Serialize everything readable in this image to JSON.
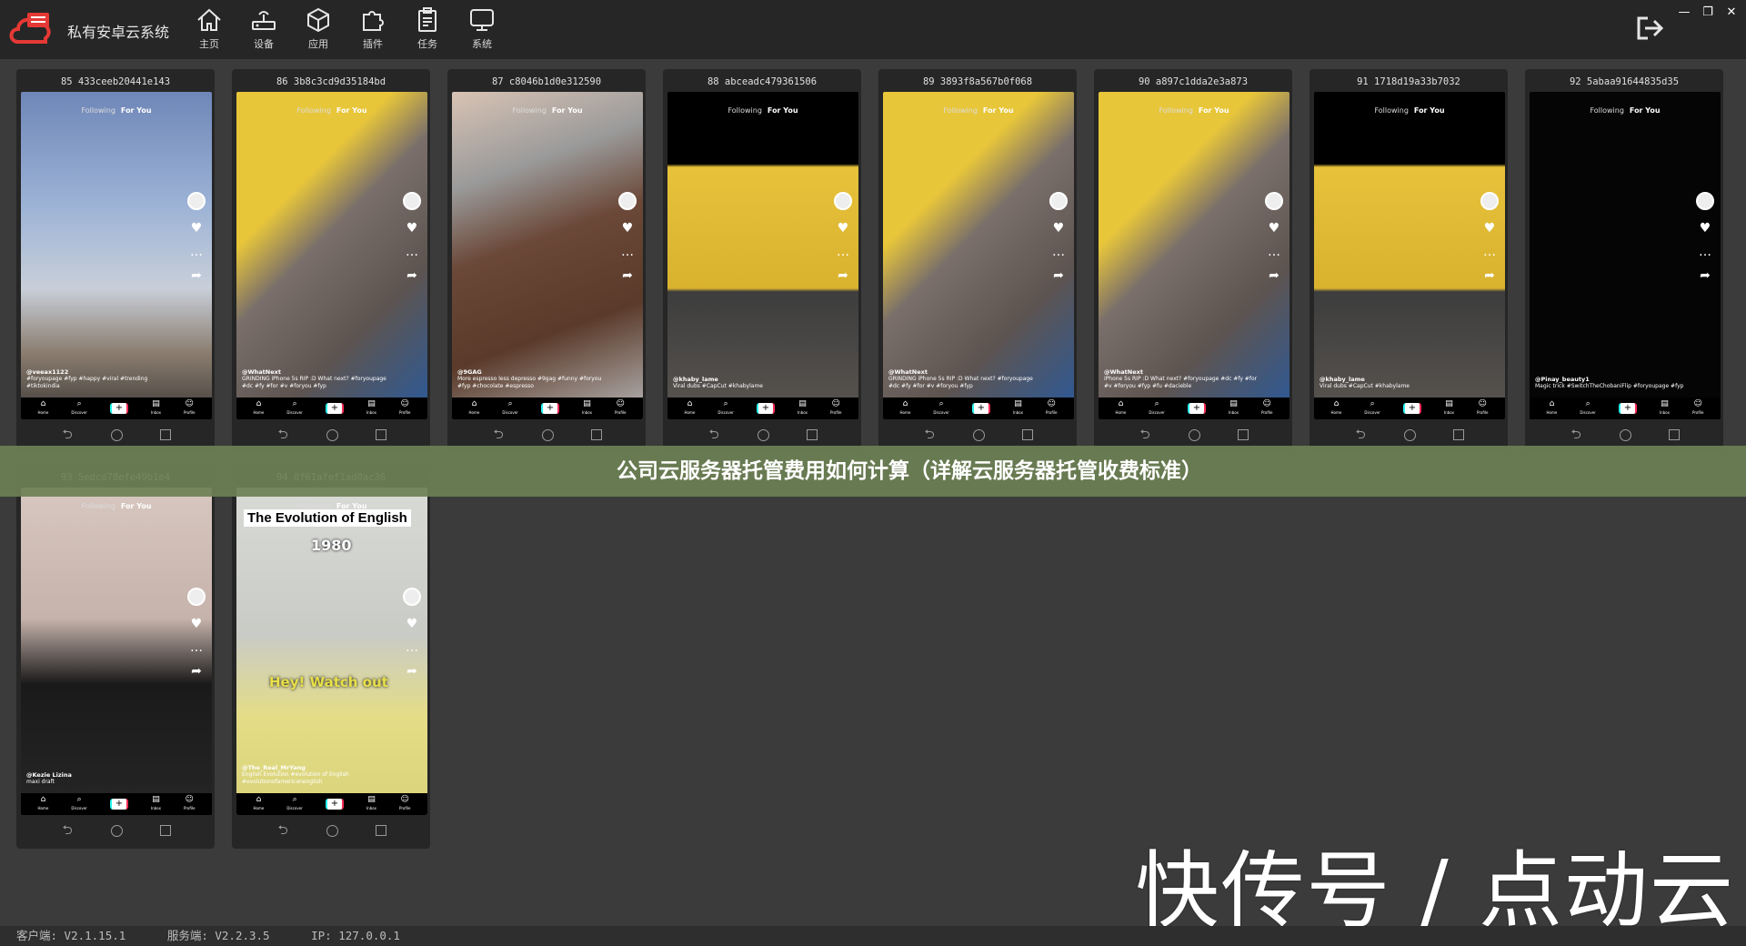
{
  "app": {
    "title": "私有安卓云系统",
    "nav": [
      {
        "label": "主页",
        "icon": "home-icon"
      },
      {
        "label": "设备",
        "icon": "device-icon"
      },
      {
        "label": "应用",
        "icon": "app-cube-icon"
      },
      {
        "label": "插件",
        "icon": "plugin-puzzle-icon"
      },
      {
        "label": "任务",
        "icon": "task-clipboard-icon"
      },
      {
        "label": "系统",
        "icon": "system-monitor-icon"
      }
    ]
  },
  "devices": [
    {
      "title": "85 433ceeb20441e143",
      "scene": "sky",
      "user": "@veeax1122",
      "caption": "#foryoupage #fyp #happy #viral #trending #tiktokindia",
      "tabs": [
        "Following",
        "For You"
      ]
    },
    {
      "title": "86 3b8c3cd9d35184bd",
      "scene": "grinder",
      "user": "@WhatNext",
      "caption": "GRINDING iPhone 5s RIP :D What next? #foryoupage #dc #fy #for #v #foryou #fyp",
      "tabs": [
        "Following",
        "For You"
      ]
    },
    {
      "title": "87 c8046b1d0e312590",
      "scene": "chocolate",
      "user": "@9GAG",
      "caption": "More espresso less depresso #9gag #funny #foryou #fyp #chocolate #espresso",
      "tabs": [
        "Following",
        "For You"
      ]
    },
    {
      "title": "88 abceadc479361506",
      "scene": "slipper",
      "user": "@khaby_lame",
      "caption": "Viral dubs #CapCut #khabylame",
      "tabs": [
        "Following",
        "For You"
      ]
    },
    {
      "title": "89 3893f8a567b0f068",
      "scene": "grinder",
      "user": "@WhatNext",
      "caption": "GRINDING iPhone 5s RIP :D What next? #foryoupage #dc #fy #for #v #foryou #fyp",
      "tabs": [
        "Following",
        "For You"
      ]
    },
    {
      "title": "90 a897c1dda2e3a873",
      "scene": "grinder",
      "user": "@WhatNext",
      "caption": "iPhone 5s RIP :D What next? #foryoupage #dc #fy #for #v #foryou #fyp #fu #dacieble",
      "tabs": [
        "Following",
        "For You"
      ]
    },
    {
      "title": "91 1718d19a33b7032",
      "scene": "slipper",
      "user": "@khaby_lame",
      "caption": "Viral dubs #CapCut #khabylame",
      "tabs": [
        "Following",
        "For You"
      ]
    },
    {
      "title": "92 5abaa91644835d35",
      "scene": "black",
      "user": "@Pinay_beauty1",
      "caption": "Magic trick #SwitchTheChobaniFlip #foryoupage #fyp",
      "tabs": [
        "Following",
        "For You"
      ]
    },
    {
      "title": "93 5edcd78efe49b1e4",
      "scene": "girl",
      "user": "@Kezie Lizina",
      "caption": "maxi draft",
      "tabs": [
        "Following",
        "For You"
      ]
    },
    {
      "title": "94 8f61afef1ad0ac36",
      "scene": "english",
      "user": "@The_Real_MrYang",
      "caption": "English Evolution #evolution of English #evolutionofamericanenglish",
      "tabs": [
        "Following",
        "For You"
      ],
      "overlay_title": "The Evolution of English",
      "overlay_year": "1980",
      "overlay_sub": "Hey!  Watch out"
    }
  ],
  "phone_bottom": [
    "Home",
    "Discover",
    "+",
    "Inbox",
    "Profile"
  ],
  "banner": "公司云服务器托管费用如何计算（详解云服务器托管收费标准）",
  "status": {
    "client": "客户端: V2.1.15.1",
    "server": "服务端: V2.2.3.5",
    "ip": "IP: 127.0.0.1"
  },
  "watermark": "快传号 / 点动云",
  "colors": {
    "topbar": "#262626",
    "banner": "#6c8054",
    "background": "#3b3b3b"
  }
}
